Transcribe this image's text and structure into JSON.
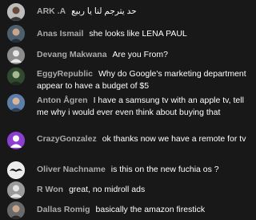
{
  "chat": {
    "messages": [
      {
        "author": "ARK .A",
        "text": "حد يترجم لنا يا ربيع",
        "avatar_color": "#c8c8c8",
        "avatar_icon": "person-photo-icon"
      },
      {
        "author": "Anas Ismail",
        "text": "she looks like LENA PAUL",
        "avatar_color": "#5a6a78",
        "avatar_icon": "person-photo-icon"
      },
      {
        "author": "Devang Makwana",
        "text": "Are you From?",
        "avatar_color": "#8c8c8c",
        "avatar_icon": "person-silhouette-icon"
      },
      {
        "author": "EggyRepublic",
        "text": "Why do Google's marketing department appear to have a budget of $5",
        "avatar_color": "#3c5a3c",
        "avatar_icon": "person-photo-icon"
      },
      {
        "author": "Anton Ågren",
        "text": "I have a samsung tv with an apple tv, tell me why i would ever even think about buying that",
        "avatar_color": "#5b7fa8",
        "avatar_icon": "person-photo-icon"
      },
      {
        "author": "CrazyGonzalez",
        "text": "ok thanks now we have a remote for tv",
        "avatar_color": "#8a3fd1",
        "avatar_icon": "person-silhouette-icon"
      },
      {
        "author": "Oliver Nachname",
        "text": "is this on the new fuchia os ?",
        "avatar_color": "#e8e8e8",
        "avatar_icon": "mustache-icon"
      },
      {
        "author": "R Won",
        "text": "great, no midroll ads",
        "avatar_color": "#9a9a9a",
        "avatar_icon": "person-silhouette-icon"
      },
      {
        "author": "Dallas Romig",
        "text": "basically the amazon firestick",
        "avatar_color": "#6a6a6a",
        "avatar_icon": "person-photo-icon"
      }
    ]
  }
}
